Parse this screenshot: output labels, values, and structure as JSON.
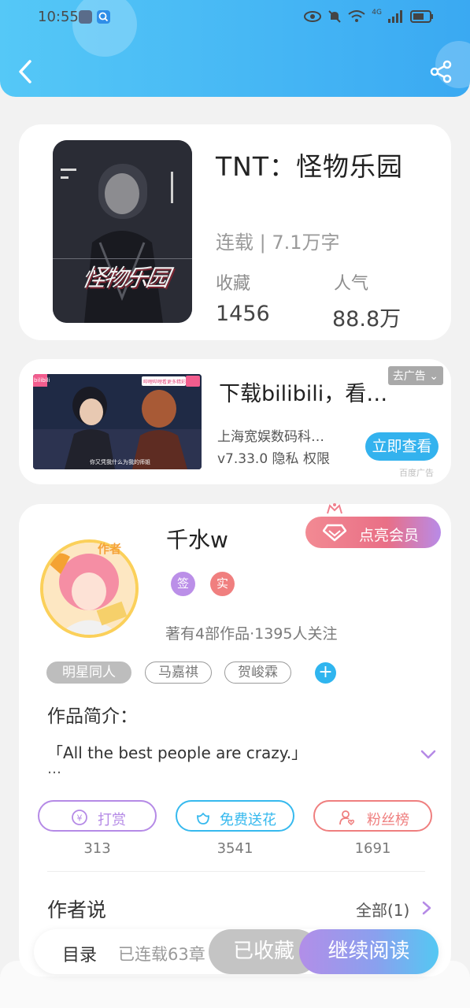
{
  "status_bar": {
    "time": "10:55",
    "network": "4G"
  },
  "book": {
    "title": "TNT：怪物乐园",
    "status": "连载 | 7.1万字",
    "favorites_label": "收藏",
    "favorites_value": "1456",
    "popularity_label": "人气",
    "popularity_value": "88.8万",
    "cover_art_text": "怪物乐园"
  },
  "ad": {
    "title": "下载bilibili，看…",
    "close_label": "去广告",
    "company": "上海宽娱数码科…",
    "version_info": "v7.33.0 隐私 权限",
    "button_label": "立即查看",
    "tag": "百度广告",
    "image_logo": "bilibili",
    "image_banner": "哔哩哔哩看更多精彩",
    "image_subtitle": "你又凭我什么为我的师姐"
  },
  "author": {
    "name": "千水w",
    "role_tag": "作者",
    "vip_button": "点亮会员",
    "badge_signed": "签",
    "badge_verified": "实",
    "meta": "著有4部作品·1395人关注",
    "tags": [
      "明星同人",
      "马嘉祺",
      "贺峻霖"
    ],
    "add_tag": "+",
    "intro_label": "作品简介：",
    "intro_text": "「All the best people are crazy.」",
    "intro_ellipsis": "…",
    "actions": [
      {
        "label": "打赏",
        "count": "313",
        "color": "#b58ae6"
      },
      {
        "label": "免费送花",
        "count": "3541",
        "color": "#36b9ee"
      },
      {
        "label": "粉丝榜",
        "count": "1691",
        "color": "#ef7f7f"
      }
    ],
    "say_label": "作者说",
    "say_all": "全部(1)"
  },
  "bottom_bar": {
    "toc_label": "目录",
    "toc_count": "已连载63章",
    "collected_label": "已收藏",
    "continue_label": "继续阅读"
  },
  "colors": {
    "header_blue": "#3aa9f2",
    "accent_blue": "#33b2ee",
    "purple": "#b58ae6",
    "coral": "#ef7f7f"
  }
}
